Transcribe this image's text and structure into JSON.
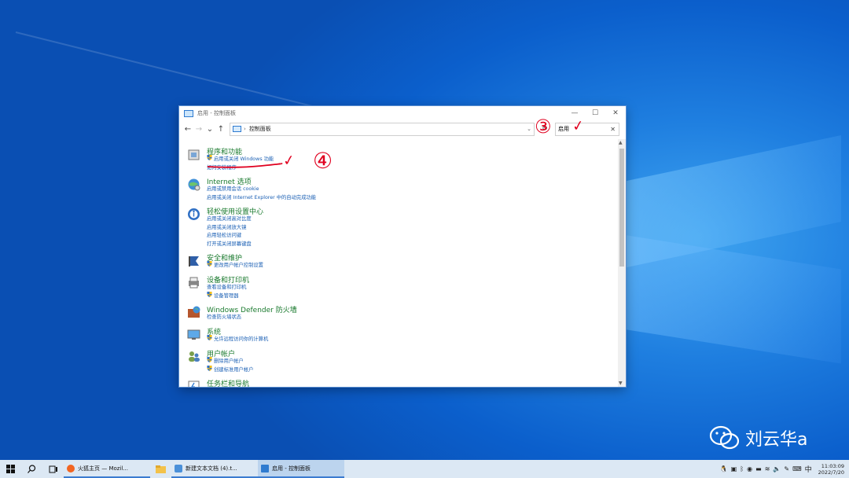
{
  "window": {
    "title": "启用 - 控制面板",
    "minimize": "—",
    "maximize": "☐",
    "close": "✕"
  },
  "address": {
    "back": "←",
    "forward": "→",
    "up_history": "⌄",
    "up": "↑",
    "path_sep": "›",
    "path": "控制面板",
    "dropdown": "⌄",
    "refresh": "↻"
  },
  "search": {
    "value": "启用",
    "clear": "✕"
  },
  "categories": [
    {
      "title": "程序和功能",
      "icon": "programs-icon",
      "links": [
        {
          "text": "启用或关闭 Windows 功能",
          "shield": true
        },
        {
          "text": "如何安装程序",
          "shield": false
        }
      ]
    },
    {
      "title": "Internet 选项",
      "icon": "internet-options-icon",
      "links": [
        {
          "text": "启用或禁用会话 cookie",
          "shield": false
        },
        {
          "text": "启用或关闭 Internet Explorer 中的自动完成功能",
          "shield": false
        }
      ]
    },
    {
      "title": "轻松使用设置中心",
      "icon": "ease-of-access-icon",
      "links": [
        {
          "text": "启用或关闭高对比度",
          "shield": false
        },
        {
          "text": "启用或关闭放大镜",
          "shield": false
        },
        {
          "text": "启用轻松访问键",
          "shield": false
        },
        {
          "text": "打开或关闭屏幕键盘",
          "shield": false
        }
      ]
    },
    {
      "title": "安全和维护",
      "icon": "security-maintenance-icon",
      "links": [
        {
          "text": "更改用户帐户控制设置",
          "shield": true
        }
      ]
    },
    {
      "title": "设备和打印机",
      "icon": "devices-printers-icon",
      "links": [
        {
          "text": "查看设备和打印机",
          "shield": false
        },
        {
          "text": "设备管理器",
          "shield": true
        }
      ]
    },
    {
      "title": "Windows Defender 防火墙",
      "icon": "firewall-icon",
      "links": [
        {
          "text": "检查防火墙状态",
          "shield": false
        }
      ]
    },
    {
      "title": "系统",
      "icon": "system-icon",
      "links": [
        {
          "text": "允许远程访问你的计算机",
          "shield": true
        }
      ]
    },
    {
      "title": "用户帐户",
      "icon": "user-accounts-icon",
      "links": [
        {
          "text": "删除用户帐户",
          "shield": true
        },
        {
          "text": "创建标准用户帐户",
          "shield": true
        }
      ]
    },
    {
      "title": "任务栏和导航",
      "icon": "taskbar-navigation-icon",
      "links": []
    }
  ],
  "annotations": {
    "step3": "③",
    "step4": "④",
    "check": "✓"
  },
  "taskbar": {
    "start_icon": "windows-start-icon",
    "apps": [
      {
        "label": "火狐主页 — Mozil...",
        "color": "#f26522"
      },
      {
        "label": "新建文本文档 (4).t...",
        "color": "#4a90d9"
      },
      {
        "label": "启用 - 控制面板",
        "color": "#2f7bd0"
      }
    ],
    "ime": "中",
    "time": "11:03:09",
    "date": "2022/7/20"
  },
  "watermark": {
    "text": "刘云华a"
  },
  "colors": {
    "category_title": "#1a7a2e",
    "link": "#1a5fb4",
    "annotation": "#e0001f",
    "taskbar": "#dce8f4"
  }
}
